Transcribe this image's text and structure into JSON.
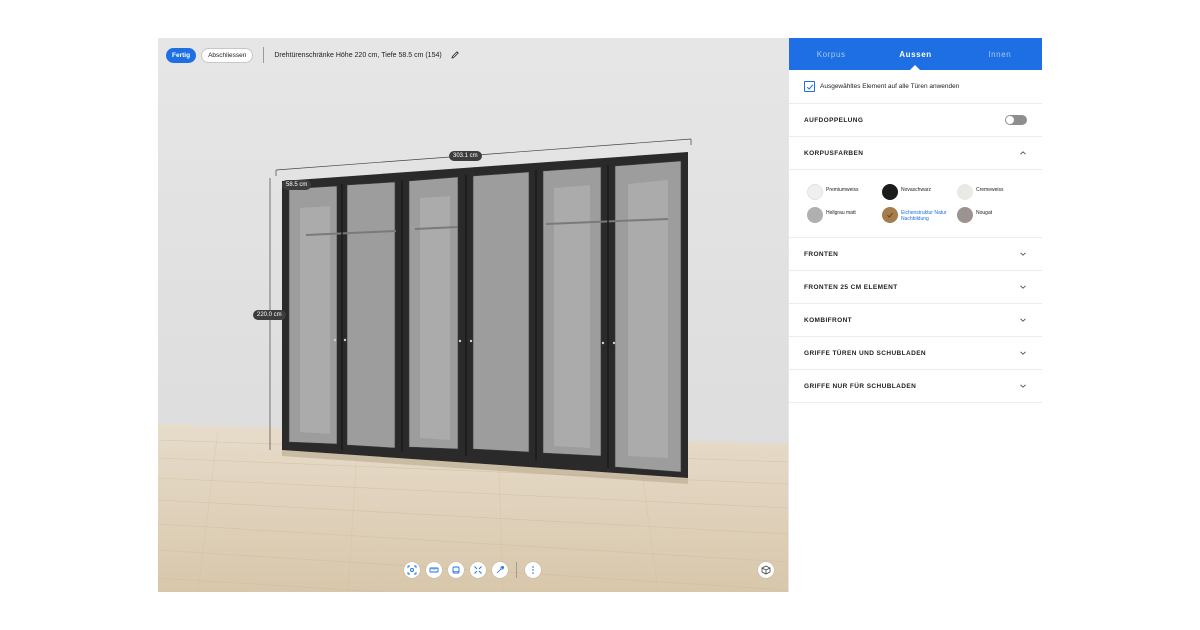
{
  "header": {
    "done_label": "Fertig",
    "finish_label": "Abschliessen",
    "project_title": "Drehtürenschränke Höhe 220 cm, Tiefe 58.5 cm (154)"
  },
  "dimensions": {
    "width": "303.1 cm",
    "depth": "58.5 cm",
    "height": "220.0 cm"
  },
  "toolbar": {
    "icons": [
      "focus-icon",
      "measure-icon",
      "layers-icon",
      "expand-icon",
      "tools-icon",
      "more-icon"
    ],
    "view_icon": "cube-icon"
  },
  "panel": {
    "tabs": [
      {
        "label": "Korpus",
        "active": false
      },
      {
        "label": "Aussen",
        "active": true
      },
      {
        "label": "Innen",
        "active": false
      }
    ],
    "apply_all": {
      "label": "Ausgewähltes Element auf alle Türen anwenden",
      "checked": true
    },
    "aufdoppelung": {
      "title": "AUFDOPPELUNG",
      "enabled": false
    },
    "korpusfarben": {
      "title": "KORPUSFARBEN",
      "expanded": true,
      "colors": [
        {
          "label": "Premiumweiss",
          "hex": "#efefef",
          "selected": false
        },
        {
          "label": "Novaschwarz",
          "hex": "#1c1c1c",
          "selected": false
        },
        {
          "label": "Cremeweiss",
          "hex": "#ebe9e4",
          "selected": false
        },
        {
          "label": "Hellgrau matt",
          "hex": "#b0b0b0",
          "selected": false
        },
        {
          "label": "Eichenstruktur Natur Nachbildung",
          "hex": "#a67c4a",
          "selected": true
        },
        {
          "label": "Nougat",
          "hex": "#9a9390",
          "selected": false
        }
      ]
    },
    "sections": [
      {
        "title": "FRONTEN"
      },
      {
        "title": "FRONTEN 25 CM ELEMENT"
      },
      {
        "title": "KOMBIFRONT"
      },
      {
        "title": "GRIFFE TÜREN UND SCHUBLADEN"
      },
      {
        "title": "GRIFFE NUR FÜR SCHUBLADEN"
      }
    ]
  }
}
